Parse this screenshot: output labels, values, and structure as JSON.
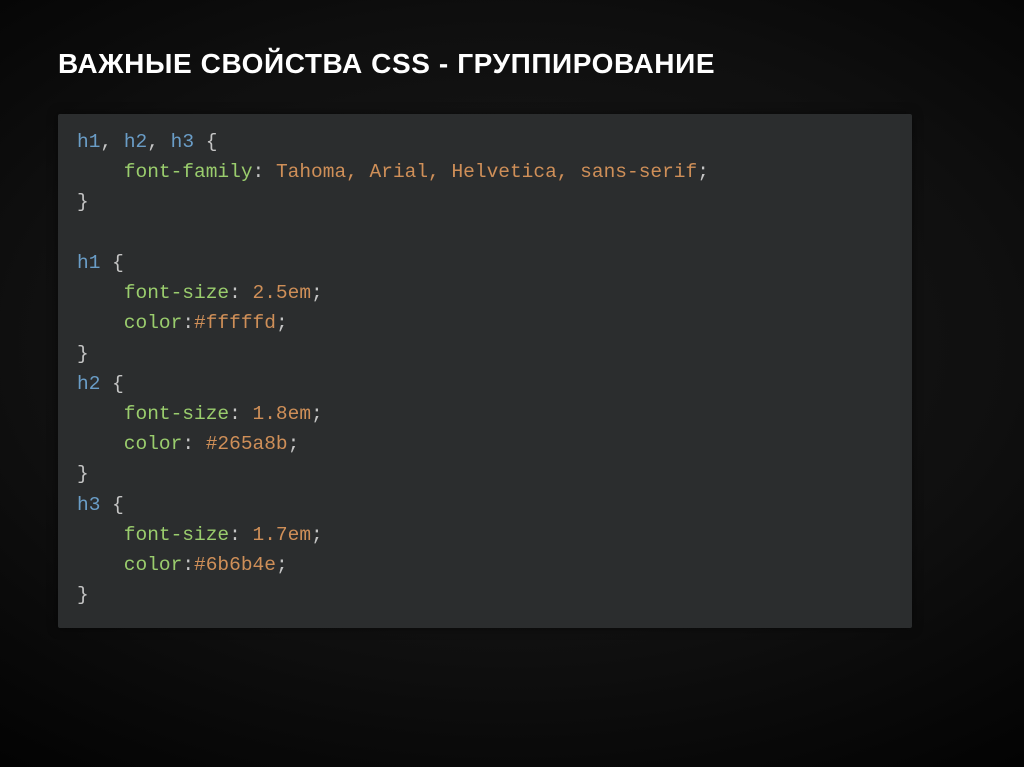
{
  "slide": {
    "title": "ВАЖНЫЕ СВОЙСТВА CSS - ГРУППИРОВАНИЕ"
  },
  "css_blocks": [
    {
      "selectors": [
        "h1",
        "h2",
        "h3"
      ],
      "declarations": [
        {
          "property": "font-family",
          "value": "Tahoma, Arial, Helvetica, sans-serif",
          "space_after_colon": true
        }
      ]
    },
    {
      "selectors": [
        "h1"
      ],
      "declarations": [
        {
          "property": "font-size",
          "value": "2.5em",
          "space_after_colon": true
        },
        {
          "property": "color",
          "value": "#fffffd",
          "space_after_colon": false
        }
      ]
    },
    {
      "selectors": [
        "h2"
      ],
      "declarations": [
        {
          "property": "font-size",
          "value": "1.8em",
          "space_after_colon": true
        },
        {
          "property": "color",
          "value": "#265a8b",
          "space_after_colon": true
        }
      ]
    },
    {
      "selectors": [
        "h3"
      ],
      "declarations": [
        {
          "property": "font-size",
          "value": "1.7em",
          "space_after_colon": true
        },
        {
          "property": "color",
          "value": "#6b6b4e",
          "space_after_colon": false
        }
      ]
    }
  ]
}
